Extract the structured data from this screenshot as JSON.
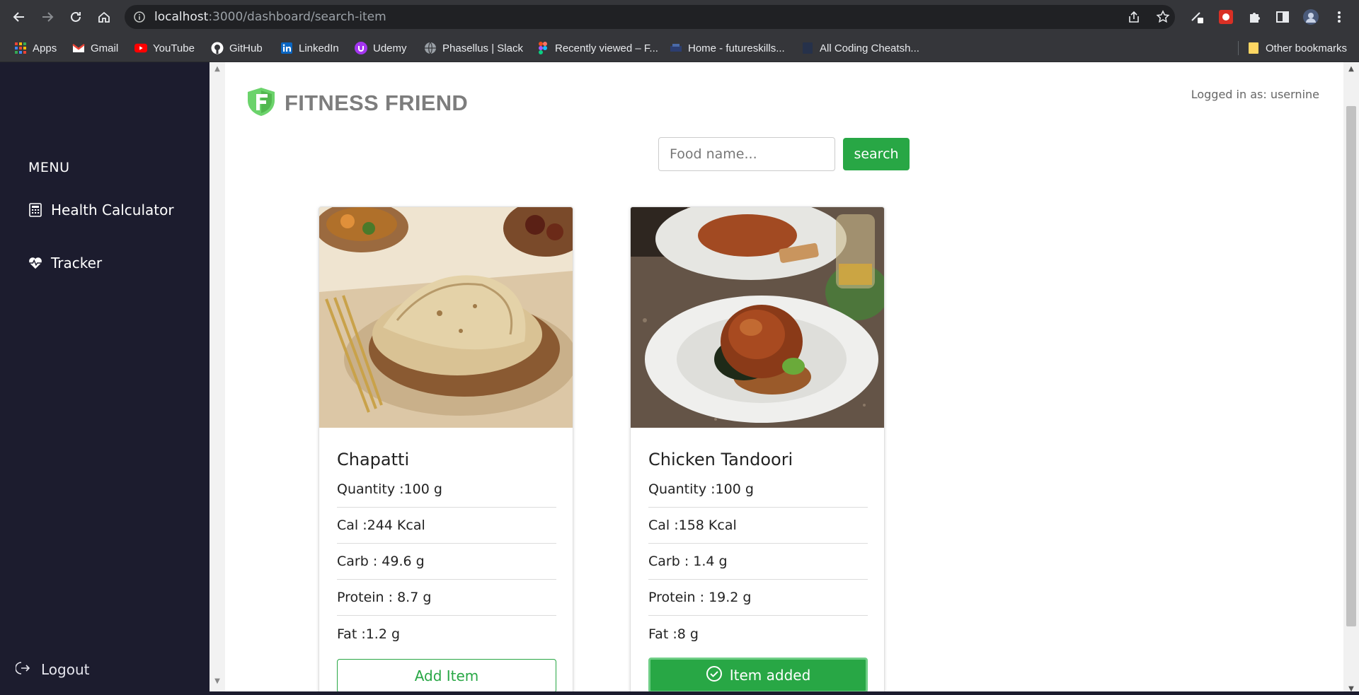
{
  "browser": {
    "url_host": "localhost",
    "url_path": ":3000/dashboard/search-item",
    "bookmarks": [
      {
        "label": "Apps",
        "icon": "apps-grid-icon"
      },
      {
        "label": "Gmail",
        "icon": "gmail-icon"
      },
      {
        "label": "YouTube",
        "icon": "youtube-icon"
      },
      {
        "label": "GitHub",
        "icon": "github-icon"
      },
      {
        "label": "LinkedIn",
        "icon": "linkedin-icon"
      },
      {
        "label": "Udemy",
        "icon": "udemy-icon"
      },
      {
        "label": "Phasellus | Slack",
        "icon": "globe-icon"
      },
      {
        "label": "Recently viewed – F...",
        "icon": "figma-icon"
      },
      {
        "label": "Home - futureskills...",
        "icon": "futureskills-icon"
      },
      {
        "label": "All Coding Cheatsh...",
        "icon": "page-icon"
      }
    ],
    "other_bookmarks": "Other bookmarks"
  },
  "sidebar": {
    "menu_title": "MENU",
    "items": [
      {
        "label": "Health Calculator",
        "icon": "calculator-icon"
      },
      {
        "label": "Tracker",
        "icon": "heartbeat-icon"
      }
    ],
    "logout_label": "Logout"
  },
  "header": {
    "logo_text": "FITNESS FRIEND",
    "logged_in": "Logged in as: usernine"
  },
  "search": {
    "placeholder": "Food name...",
    "button_label": "search"
  },
  "colors": {
    "accent": "#28a745",
    "sidebar_bg": "#1c1c2e"
  },
  "foods": [
    {
      "name": "Chapatti",
      "quantity": "Quantity :100 g",
      "cal": "Cal :244 Kcal",
      "carb": "Carb : 49.6 g",
      "protein": "Protein : 8.7 g",
      "fat": "Fat :1.2 g",
      "button_label": "Add Item"
    },
    {
      "name": "Chicken Tandoori",
      "quantity": "Quantity :100 g",
      "cal": "Cal :158 Kcal",
      "carb": "Carb : 1.4 g",
      "protein": "Protein : 19.2 g",
      "fat": "Fat :8 g",
      "button_label": "Item added"
    }
  ]
}
